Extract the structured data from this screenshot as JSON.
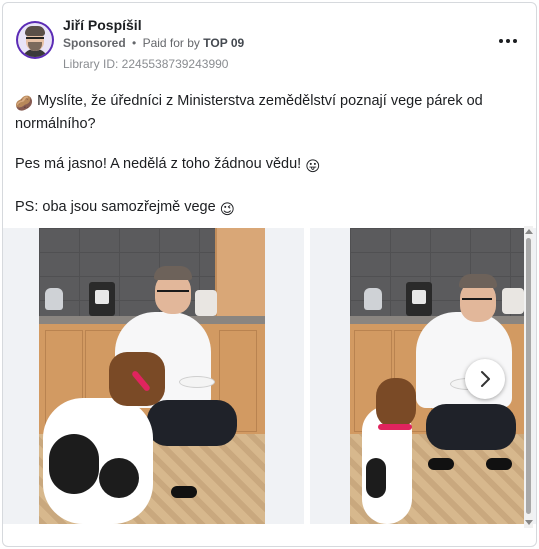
{
  "post": {
    "author": "Jiří Pospíšil",
    "sponsored_label": "Sponsored",
    "separator": "•",
    "paid_for_by_label": "Paid for by",
    "payer": "TOP 09",
    "library_id": "Library ID: 2245538739243990",
    "more_icon": "more-horizontal-icon",
    "text": {
      "line1_emoji": "🥔",
      "line1": "Myslíte, že úředníci z Ministerstva zemědělství poznají vege párek od normálního?",
      "line2": "Pes má jasno! A nedělá z toho žádnou vědu!",
      "line2_emoji": "😛",
      "line3": "PS: oba jsou samozřejmě vege",
      "line3_emoji": "😉"
    }
  },
  "carousel": {
    "next_icon": "chevron-right-icon",
    "slides": [
      {
        "image": "man-in-kitchen-feeding-beagle",
        "watermark": ""
      },
      {
        "image": "man-in-kitchen-feeding-beagle-closeup",
        "watermark": ""
      }
    ]
  },
  "colors": {
    "accent": "#e0245e",
    "text": "#1c1e21",
    "meta": "#65676b"
  }
}
